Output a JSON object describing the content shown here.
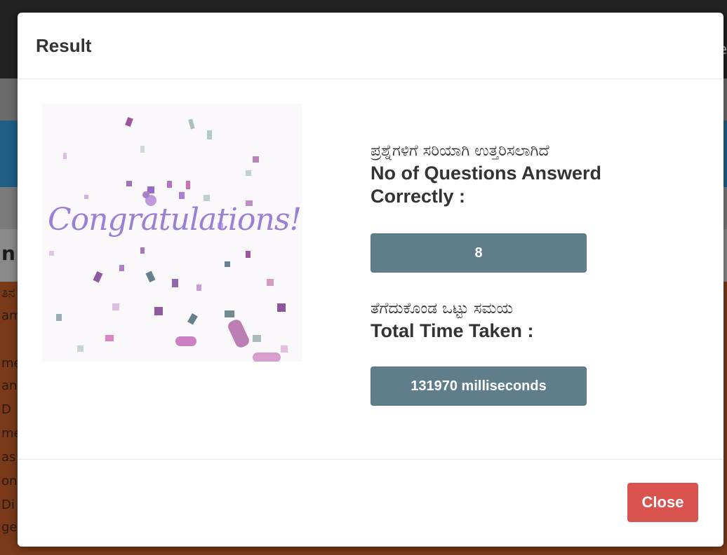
{
  "background": {
    "fragments": [
      "ತಿನ",
      "am",
      "me",
      "an",
      "D",
      "me",
      "as",
      "on",
      "Di",
      "ge"
    ],
    "heading_fragment": "n",
    "right_fragment": "e"
  },
  "modal": {
    "title": "Result",
    "image_text": "Congratulations!",
    "correct_label_kn": "ಪ್ರಶ್ನೆಗಳಿಗೆ ಸರಿಯಾಗಿ ಉತ್ತರಿಸಲಾಗಿದೆ",
    "correct_label_en": "No of Questions Answerd Correctly :",
    "correct_value": "8",
    "time_label_kn": "ತೆಗೆದುಕೊಂಡ ಒಟ್ಟು ಸಮಯ",
    "time_label_en": "Total Time Taken :",
    "time_value": "131970 milliseconds",
    "close_label": "Close"
  },
  "colors": {
    "value_box": "#607d8b",
    "close_button": "#d9534f",
    "congrats_text": "#9a7fd6"
  }
}
